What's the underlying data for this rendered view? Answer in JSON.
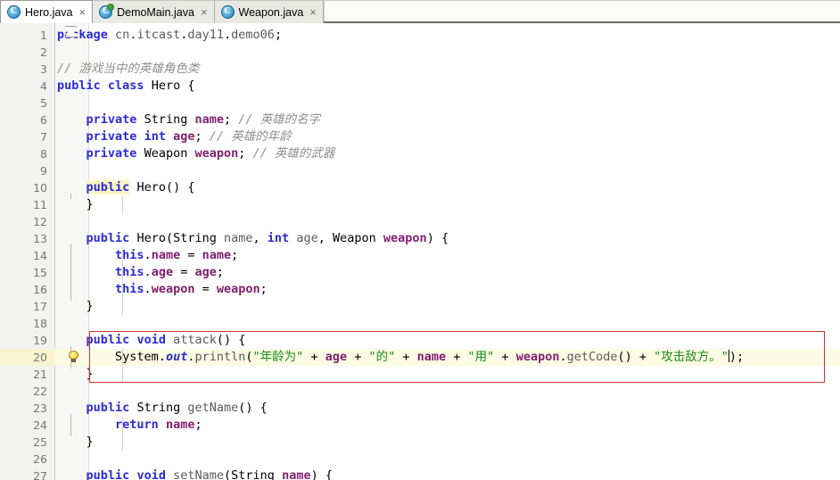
{
  "window": {
    "title": "Hero.java",
    "type": "java-code-editor"
  },
  "colors": {
    "tab_active_bg": "#ffffff",
    "tab_inactive_bg": "#e9e9e4",
    "gutter_bg": "#f2f2f0",
    "editor_bg": "#ffffff",
    "current_line_bg": "#fcfbe4",
    "annotation_red": "#c0392b",
    "keyword": "#7f0055",
    "keyword_blue": "#2b2bd8",
    "comment": "#8e8e8e",
    "string": "#1a8b1a",
    "field": "#7f1f6e",
    "bulb_yellow": "#ffd84d",
    "run_badge_green": "#3fa535"
  },
  "tabbar": {
    "tabs": [
      {
        "label": "Hero.java",
        "icon": "java-class-icon",
        "active": true,
        "close_glyph": "×",
        "icon_letter": "C",
        "run_badge": false
      },
      {
        "label": "DemoMain.java",
        "icon": "java-class-icon",
        "active": false,
        "close_glyph": "×",
        "icon_letter": "C",
        "run_badge": true
      },
      {
        "label": "Weapon.java",
        "icon": "java-class-icon",
        "active": false,
        "close_glyph": "×",
        "icon_letter": "C",
        "run_badge": false
      }
    ]
  },
  "editor": {
    "language": "java",
    "current_line": 20,
    "caret_line": 20,
    "first_visible_line": 1,
    "last_visible_line": 27,
    "line_numbers": [
      1,
      2,
      3,
      4,
      5,
      6,
      7,
      8,
      9,
      10,
      11,
      12,
      13,
      14,
      15,
      16,
      17,
      18,
      19,
      20,
      21,
      22,
      23,
      24,
      25,
      26,
      27
    ],
    "quick_fix_hint": {
      "line": 20,
      "icon": "lightbulb-icon"
    },
    "annotation_box": {
      "from_line": 19,
      "to_line": 21,
      "color": "#c0392b"
    },
    "fold_markers": [
      {
        "line": 10,
        "state": "open"
      },
      {
        "line": 11,
        "state": "close"
      },
      {
        "line": 13,
        "state": "open"
      },
      {
        "line": 17,
        "state": "close"
      },
      {
        "line": 19,
        "state": "open"
      },
      {
        "line": 21,
        "state": "close"
      },
      {
        "line": 23,
        "state": "open"
      },
      {
        "line": 25,
        "state": "close"
      },
      {
        "line": 27,
        "state": "open"
      }
    ],
    "lines": [
      {
        "n": 1,
        "text": "package cn.itcast.day11.demo06;"
      },
      {
        "n": 2,
        "text": ""
      },
      {
        "n": 3,
        "text": "// 游戏当中的英雄角色类"
      },
      {
        "n": 4,
        "text": "public class Hero {"
      },
      {
        "n": 5,
        "text": ""
      },
      {
        "n": 6,
        "text": "    private String name; // 英雄的名字"
      },
      {
        "n": 7,
        "text": "    private int age; // 英雄的年龄"
      },
      {
        "n": 8,
        "text": "    private Weapon weapon; // 英雄的武器"
      },
      {
        "n": 9,
        "text": ""
      },
      {
        "n": 10,
        "text": "    public Hero() {"
      },
      {
        "n": 11,
        "text": "    }"
      },
      {
        "n": 12,
        "text": ""
      },
      {
        "n": 13,
        "text": "    public Hero(String name, int age, Weapon weapon) {"
      },
      {
        "n": 14,
        "text": "        this.name = name;"
      },
      {
        "n": 15,
        "text": "        this.age = age;"
      },
      {
        "n": 16,
        "text": "        this.weapon = weapon;"
      },
      {
        "n": 17,
        "text": "    }"
      },
      {
        "n": 18,
        "text": ""
      },
      {
        "n": 19,
        "text": "    public void attack() {"
      },
      {
        "n": 20,
        "text": "        System.out.println(\"年龄为\" + age + \"的\" + name + \"用\" + weapon.getCode() + \"攻击敌方。\");"
      },
      {
        "n": 21,
        "text": "    }"
      },
      {
        "n": 22,
        "text": ""
      },
      {
        "n": 23,
        "text": "    public String getName() {"
      },
      {
        "n": 24,
        "text": "        return name;"
      },
      {
        "n": 25,
        "text": "    }"
      },
      {
        "n": 26,
        "text": ""
      },
      {
        "n": 27,
        "text": "    public void setName(String name) {"
      }
    ]
  }
}
